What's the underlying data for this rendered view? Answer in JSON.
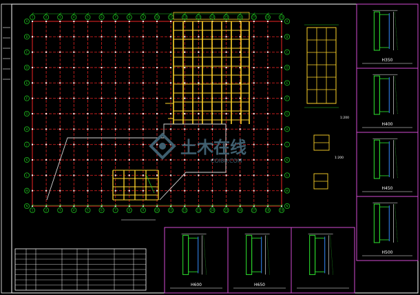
{
  "drawing": {
    "colors": {
      "background": "#000000",
      "frame": "#ffffff",
      "main_grid": "#c81e1e",
      "steel_beams": "#ffd42a",
      "axis_bubbles": "#1fc01f",
      "dimension_lines": "#1fc01f",
      "detail_frame": "#d54bd5",
      "detail_steel": "#2bd52b",
      "watermark": "#3f5f6f"
    },
    "watermark": {
      "logo_text": "土木在线",
      "sub_text": "COI88.COM"
    },
    "main_plan": {
      "title": "",
      "column_axes": [
        "1",
        "2",
        "3",
        "4",
        "5",
        "6",
        "7",
        "8",
        "9",
        "10",
        "11",
        "12",
        "13",
        "14",
        "15",
        "16",
        "17",
        "18",
        "19"
      ],
      "row_axes": [
        "A",
        "B",
        "C",
        "D",
        "E",
        "F",
        "G",
        "H",
        "J",
        "K",
        "L",
        "M",
        "N"
      ],
      "room_label": ""
    },
    "side_details": [
      {
        "title": "",
        "scale": "1:200"
      },
      {
        "title": "",
        "scale": "1:200"
      },
      {
        "title": "",
        "scale": ""
      }
    ],
    "section_details_right": [
      {
        "title": "H350",
        "suffix": ""
      },
      {
        "title": "H400",
        "suffix": ""
      },
      {
        "title": "H450",
        "suffix": ""
      },
      {
        "title": "H500",
        "suffix": ""
      }
    ],
    "section_details_bottom": [
      {
        "title": "H600",
        "suffix": ""
      },
      {
        "title": "H650",
        "suffix": ""
      },
      {
        "title": "",
        "suffix": ""
      }
    ],
    "notes": {
      "heading": "",
      "lines": []
    },
    "schedule_table": {
      "title": "",
      "header": [
        "",
        "",
        "",
        "",
        "",
        "",
        "",
        ""
      ],
      "row_count": 7
    }
  }
}
